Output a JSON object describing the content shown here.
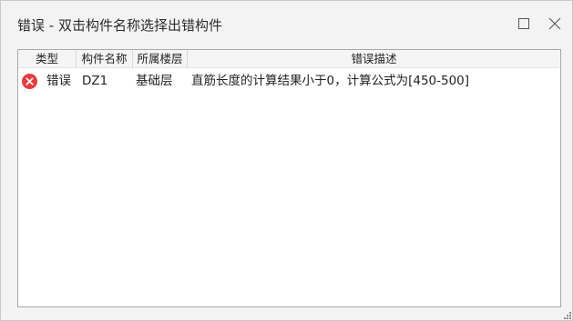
{
  "window": {
    "title": "错误 - 双击构件名称选择出错构件",
    "maximize_icon": "maximize-icon",
    "close_icon": "close-icon"
  },
  "table": {
    "columns": [
      "类型",
      "构件名称",
      "所属楼层",
      "错误描述"
    ],
    "rows": [
      {
        "icon": "error-icon",
        "type": "错误",
        "name": "DZ1",
        "floor": "基础层",
        "description": "直筋长度的计算结果小于0，计算公式为[450-500]"
      }
    ]
  },
  "colors": {
    "error_icon": "#e8393c",
    "window_bg": "#f3f3f3",
    "table_bg": "#ffffff",
    "header_bg": "#f5f5f5"
  }
}
